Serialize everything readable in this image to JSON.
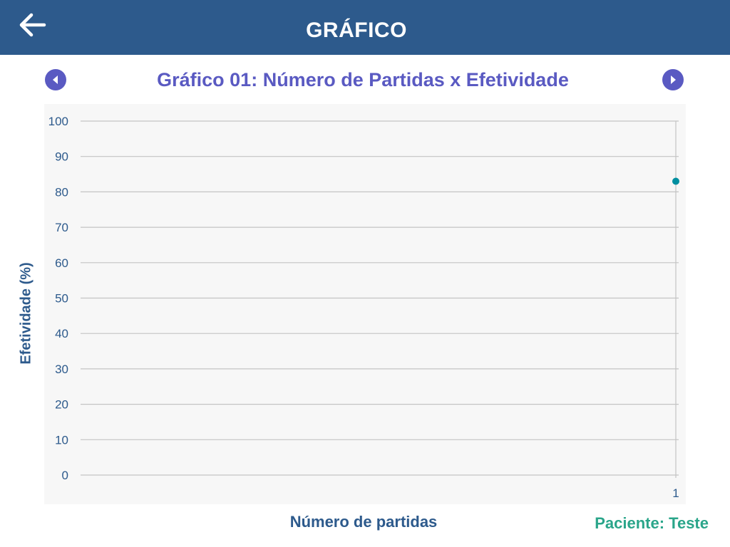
{
  "header": {
    "title": "GRÁFICO",
    "back_icon": "arrow-left-icon"
  },
  "chart_nav": {
    "prev_icon": "triangle-left-icon",
    "next_icon": "triangle-right-icon",
    "button_color": "#5a5ac2"
  },
  "chart_title": "Gráfico 01: Número de Partidas x Efetividade",
  "chart_data": {
    "type": "scatter",
    "xlabel": "Número de partidas",
    "ylabel": "Efetividade (%)",
    "x_ticks": [
      "1"
    ],
    "y_ticks": [
      0,
      10,
      20,
      30,
      40,
      50,
      60,
      70,
      80,
      90,
      100
    ],
    "ylim": [
      0,
      100
    ],
    "grid": true,
    "point_color": "#008fa0",
    "series": [
      {
        "points": [
          {
            "x": 1,
            "y": 83
          }
        ]
      }
    ]
  },
  "patient": {
    "label": "Paciente:",
    "name": "Teste"
  },
  "colors": {
    "appbar": "#2d5a8c",
    "title": "#5a5ac2",
    "axis_text": "#2d5a8c",
    "patient": "#2aa58a"
  }
}
